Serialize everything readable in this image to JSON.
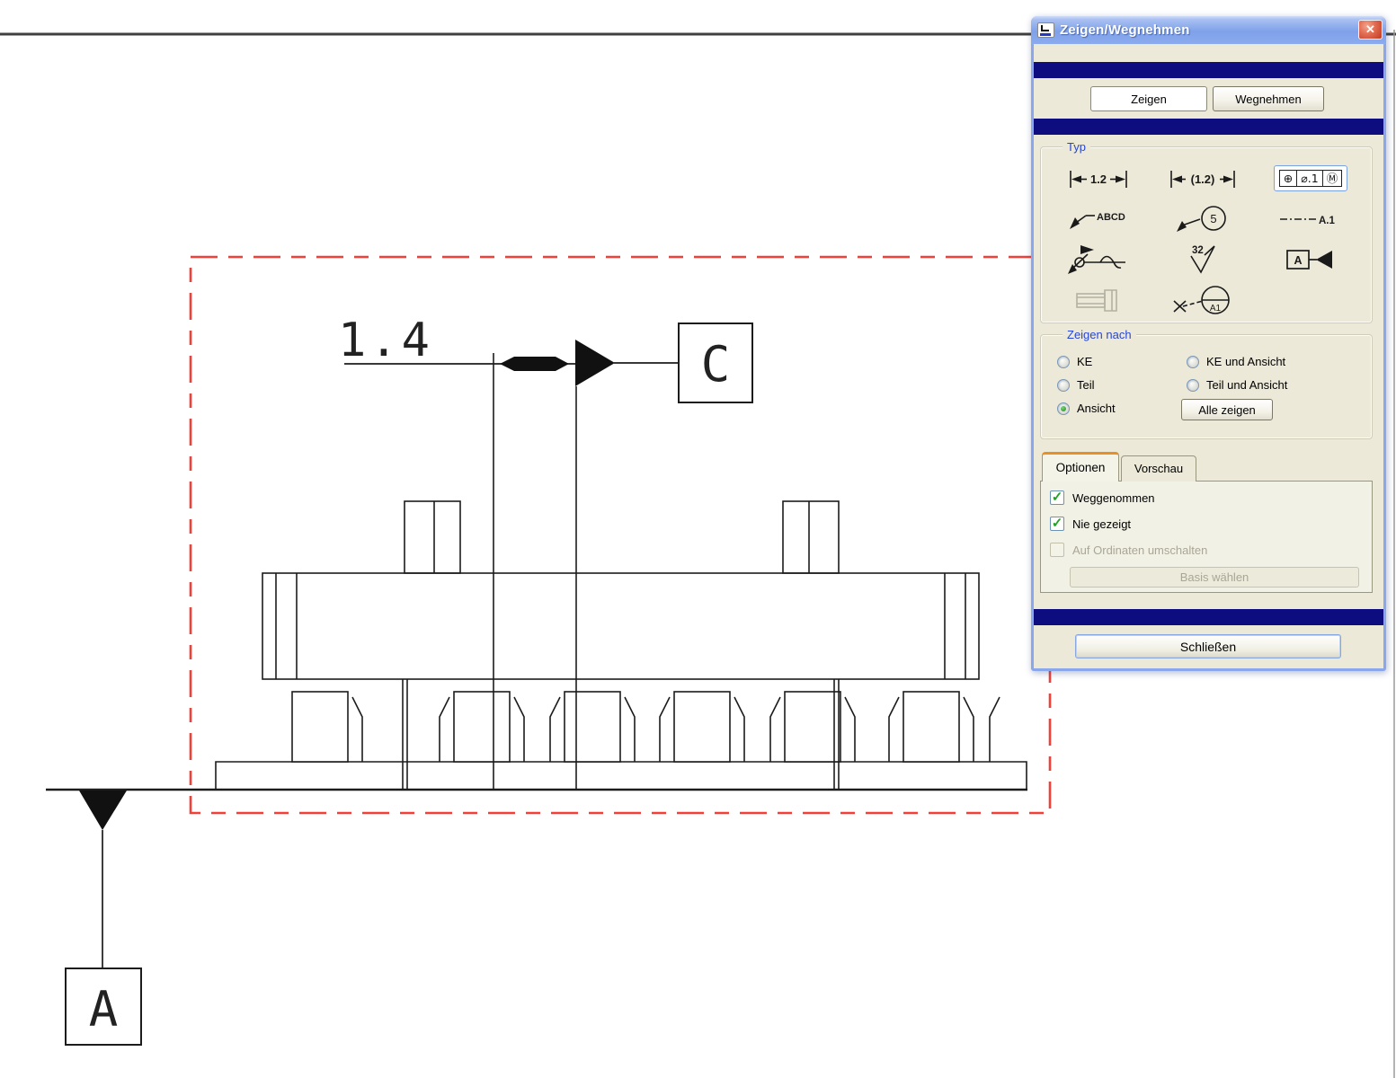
{
  "window": {
    "title": "Zeigen/Wegnehmen"
  },
  "glyphs": {
    "close": "✕",
    "check": "✓"
  },
  "actions": {
    "zeigen": "Zeigen",
    "wegnehmen": "Wegnehmen"
  },
  "typ": {
    "label": "Typ",
    "dim_value": "1.2",
    "refdim_value": "(1.2)",
    "gtol": {
      "sym": "⊕",
      "tol": "⌀.1",
      "mod": "Ⓜ"
    },
    "note_text": "ABCD",
    "balloon_number": "5",
    "axis_name": "A.1",
    "surface_value": "32",
    "datum_letter": "A",
    "target_name": "A1"
  },
  "zeigen_nach": {
    "label": "Zeigen nach",
    "options": {
      "ke": "KE",
      "teil": "Teil",
      "ansicht": "Ansicht",
      "ke_ansicht": "KE und Ansicht",
      "teil_ansicht": "Teil und Ansicht"
    },
    "selected": "Ansicht",
    "alle_zeigen": "Alle zeigen"
  },
  "tabs": {
    "optionen": "Optionen",
    "vorschau": "Vorschau",
    "active": "Optionen"
  },
  "optionen_tab": {
    "weggenommen": "Weggenommen",
    "nie_gezeigt": "Nie gezeigt",
    "ordinaten": "Auf Ordinaten umschalten",
    "weggenommen_checked": true,
    "nie_gezeigt_checked": true,
    "ordinaten_checked": false,
    "basis_waehlen": "Basis wählen"
  },
  "footer": {
    "schliessen": "Schließen"
  },
  "drawing": {
    "finish_value": "1.4",
    "datum_c": "C",
    "datum_a": "A"
  },
  "colors": {
    "selection_red": "#f23f38",
    "navy_band": "#0d0d80",
    "xp_frame": "#8aa7ec",
    "check_green": "#21a321",
    "group_label_blue": "#2746d2",
    "sheet_line": "#3f3f3f"
  }
}
